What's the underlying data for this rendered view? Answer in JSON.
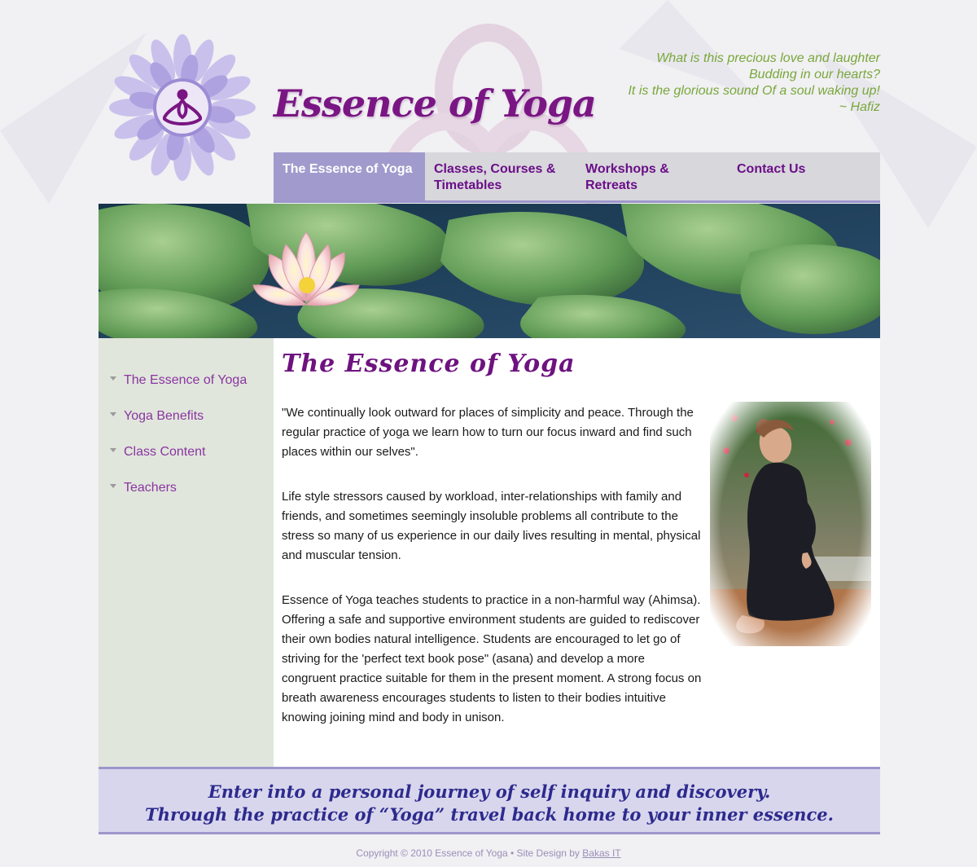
{
  "header": {
    "site_title": "Essence of Yoga",
    "quote_lines": [
      "What is this precious love and laughter",
      "Budding in our hearts?",
      "It is the glorious sound Of a soul waking up!",
      "~ Hafiz"
    ]
  },
  "nav": {
    "items": [
      {
        "label": "The Essence of Yoga",
        "active": true
      },
      {
        "label": "Classes, Courses & Timetables",
        "active": false
      },
      {
        "label": "Workshops & Retreats",
        "active": false
      },
      {
        "label": "Contact Us",
        "active": false
      }
    ]
  },
  "sidebar": {
    "items": [
      {
        "label": "The Essence of Yoga"
      },
      {
        "label": "Yoga Benefits"
      },
      {
        "label": "Class Content"
      },
      {
        "label": "Teachers"
      }
    ]
  },
  "main": {
    "heading": "The Essence of Yoga",
    "paragraphs": [
      "\"We continually look outward for places of simplicity and peace. Through the regular practice of yoga we learn how to turn our focus inward and find such places within our selves\".",
      "Life style stressors caused by workload, inter-relationships with family and friends, and sometimes seemingly insoluble problems all contribute to the stress so many of us experience in our daily lives resulting in mental, physical and muscular tension.",
      "Essence of Yoga teaches students to practice in a non-harmful way (Ahimsa). Offering a safe and supportive environment students are guided to rediscover their own bodies natural intelligence. Students are encouraged to let go of striving for the 'perfect text book pose\" (asana) and develop a more congruent practice suitable for them in the present moment. A strong focus on breath awareness encourages students to listen to their bodies intuitive knowing joining mind and body in unison."
    ]
  },
  "footer": {
    "tagline_lines": [
      "Enter into a personal journey of self inquiry and discovery.",
      "Through the practice of “Yoga” travel back home to your inner essence."
    ],
    "copyright_text": "Copyright © 2010 Essence of Yoga • Site Design by",
    "designer_link": "Bakas IT"
  },
  "colors": {
    "brand_purple": "#7a1683",
    "nav_active_bg": "#a19acd",
    "quote_green": "#78a83a",
    "sidebar_bg": "#e0e6dc",
    "footer_band_bg": "#d8d6ec"
  },
  "icons": {
    "logo": "lotus-meditation-icon",
    "sidebar_bullet": "triangle-down-icon"
  }
}
